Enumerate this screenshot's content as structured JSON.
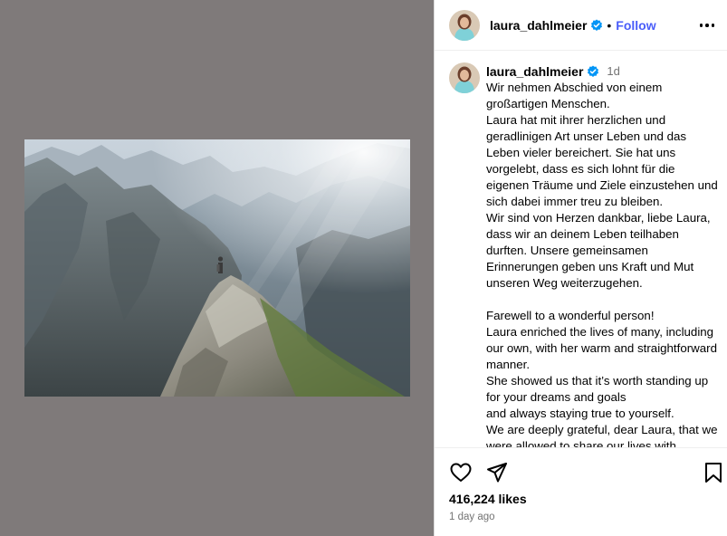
{
  "post": {
    "username": "laura_dahlmeier",
    "verified": true,
    "separator": "•",
    "follow_label": "Follow",
    "more_icon": "more-horizontal-icon"
  },
  "caption": {
    "username": "laura_dahlmeier",
    "time_ago_short": "1d",
    "text": "Wir nehmen Abschied von einem großartigen Menschen.\nLaura hat mit ihrer herzlichen und geradlinigen Art unser Leben und das Leben vieler bereichert. Sie hat uns vorgelebt, dass es sich lohnt für die eigenen Träume und Ziele einzustehen und sich dabei immer treu zu bleiben.\nWir sind von Herzen dankbar, liebe Laura, dass wir an deinem Leben teilhaben durften. Unsere gemeinsamen Erinnerungen geben uns Kraft und Mut unseren Weg weiterzugehen.\n\nFarewell to a wonderful person!\nLaura enriched the lives of many, including our own, with her warm and straightforward manner.\nShe showed us that it’s worth standing up for your dreams and goals\nand always staying true to yourself.\nWe are deeply grateful, dear Laura, that we were allowed to share our lives with"
  },
  "actions": {
    "like_icon": "heart-icon",
    "share_icon": "paper-plane-icon",
    "save_icon": "bookmark-icon"
  },
  "likes_text": "416,224 likes",
  "time_ago_full": "1 day ago",
  "colors": {
    "media_background": "#7f7a7a",
    "follow_blue": "#4a5df9",
    "verified_blue": "#0095f6",
    "muted_text": "#737373"
  }
}
